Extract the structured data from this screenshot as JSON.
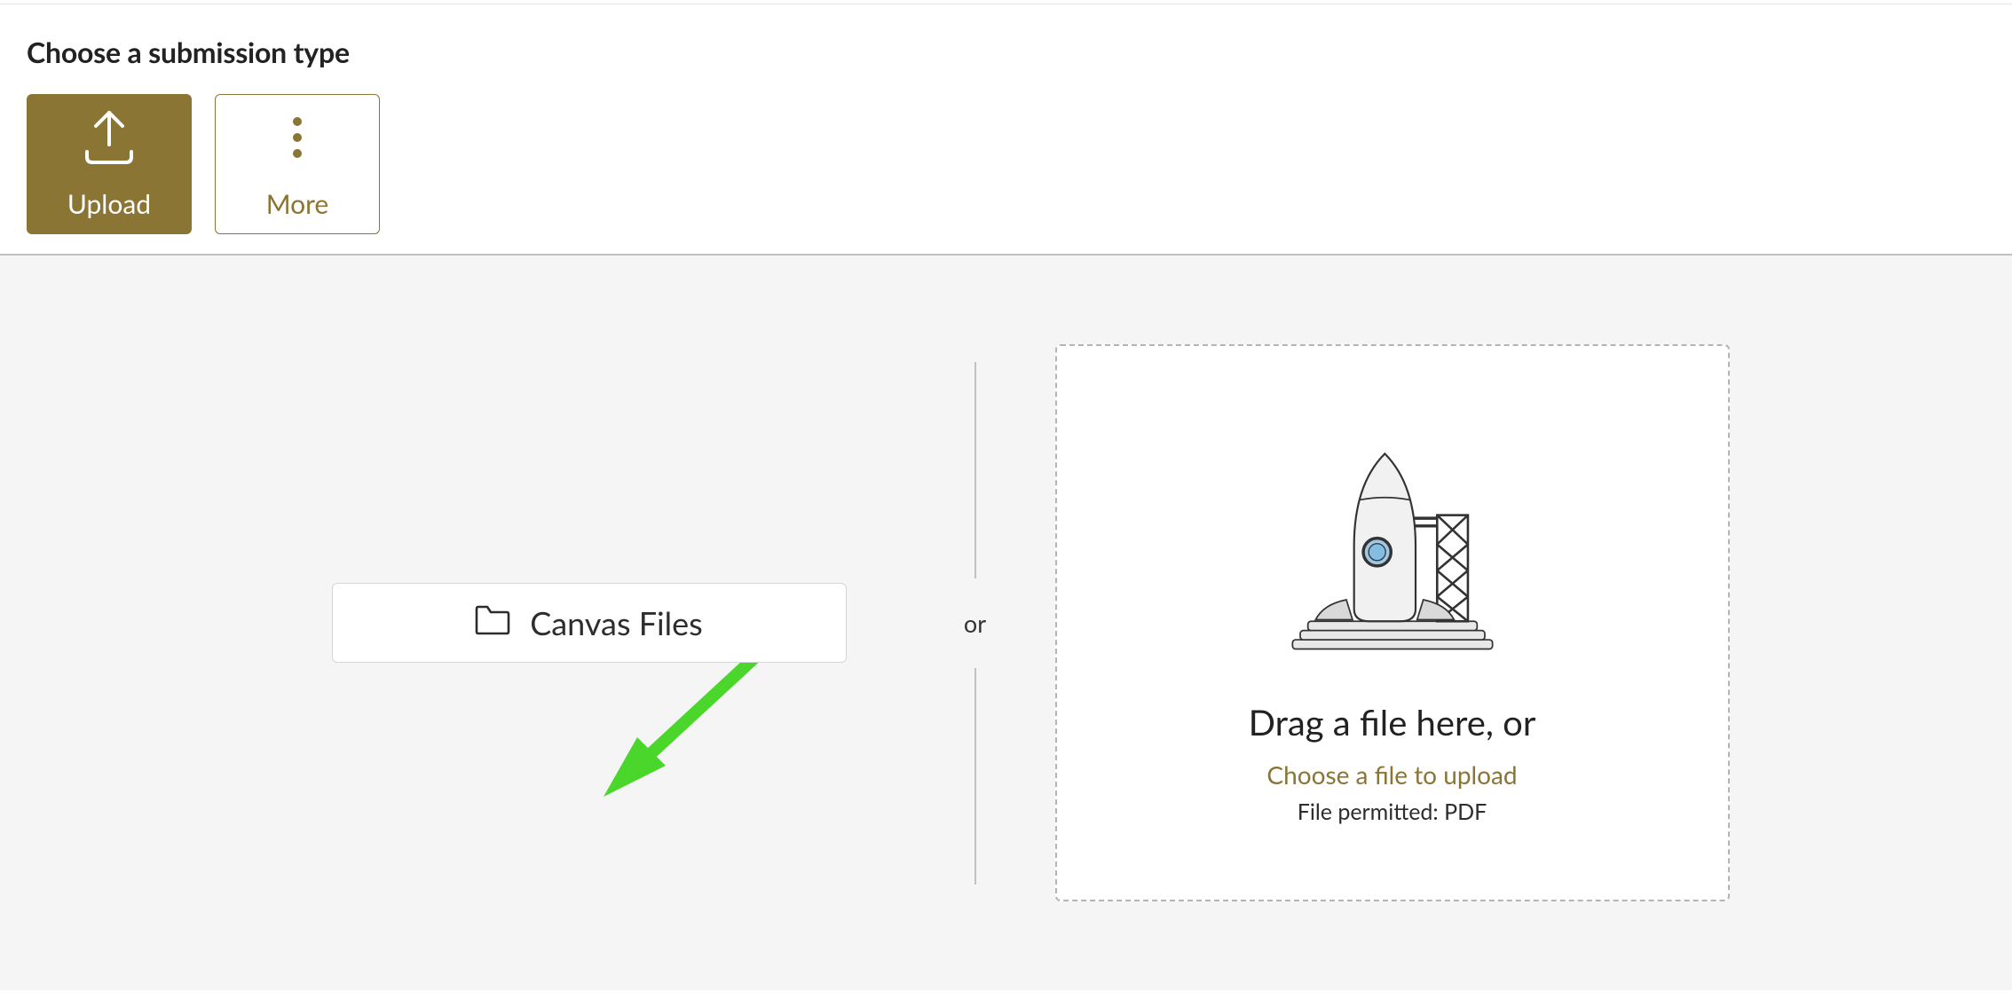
{
  "header": {
    "title": "Choose a submission type"
  },
  "tabs": {
    "upload_label": "Upload",
    "more_label": "More"
  },
  "panel": {
    "canvas_files_label": "Canvas Files",
    "or_label": "or",
    "drag_title": "Drag a file here, or",
    "choose_link": "Choose a file to upload",
    "permitted_text": "File permitted: PDF"
  },
  "colors": {
    "accent": "#8a7535",
    "arrow": "#4bd62c"
  }
}
